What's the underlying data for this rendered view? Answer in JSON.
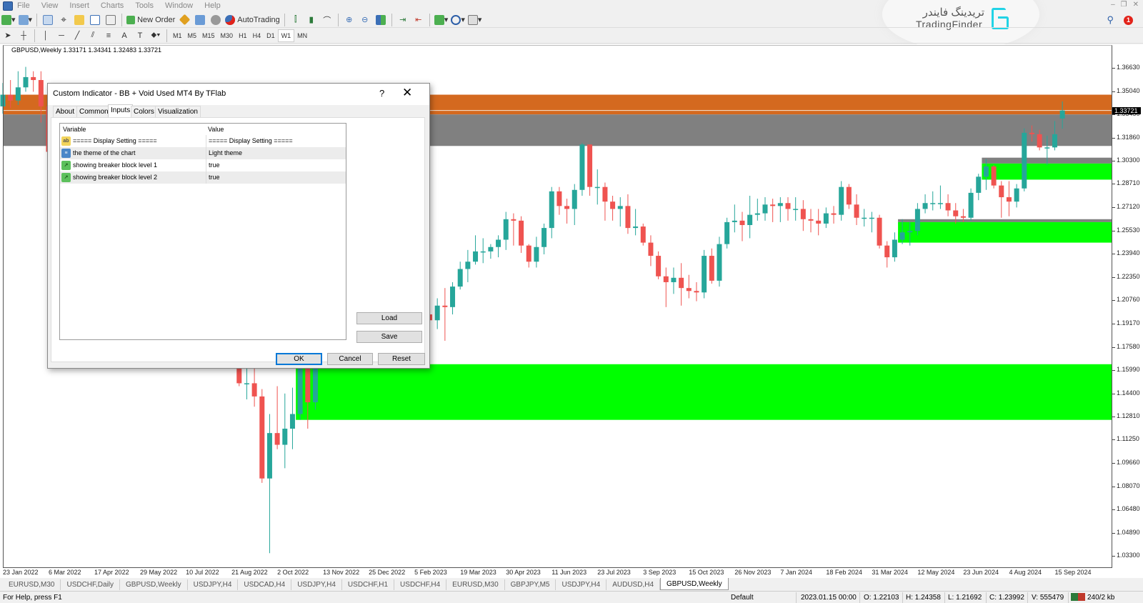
{
  "menu": {
    "items": [
      "File",
      "View",
      "Insert",
      "Charts",
      "Tools",
      "Window",
      "Help"
    ]
  },
  "toolbar": {
    "new_order": "New Order",
    "autotrading": "AutoTrading",
    "timeframes": [
      "M1",
      "M5",
      "M15",
      "M30",
      "H1",
      "H4",
      "D1",
      "W1",
      "MN"
    ],
    "active_timeframe": "W1",
    "notification_count": "1"
  },
  "logo": {
    "fa": "تریدینگ فایندر",
    "en": "TradingFinder"
  },
  "chart": {
    "header": "GBPUSD,Weekly  1.33171 1.34341 1.32483 1.33721",
    "current_price": "1.33721",
    "colors": {
      "bull": "#26a69a",
      "bear": "#ef5350",
      "supply_zone": "#d4691f",
      "gray_zone": "#808080",
      "demand_zone": "#00ff00"
    }
  },
  "chart_data": {
    "type": "candlestick",
    "symbol": "GBPUSD",
    "timeframe": "Weekly",
    "first_bar": "2022-01-23",
    "ylim": [
      1.033,
      1.3663
    ],
    "price_ticks": [
      "1.36630",
      "1.35040",
      "1.33450",
      "1.31860",
      "1.30300",
      "1.28710",
      "1.27120",
      "1.25530",
      "1.23940",
      "1.22350",
      "1.20760",
      "1.19170",
      "1.17580",
      "1.15990",
      "1.14400",
      "1.12810",
      "1.11250",
      "1.09660",
      "1.08070",
      "1.06480",
      "1.04890",
      "1.03300"
    ],
    "date_ticks": [
      "23 Jan 2022",
      "6 Mar 2022",
      "17 Apr 2022",
      "29 May 2022",
      "10 Jul 2022",
      "21 Aug 2022",
      "2 Oct 2022",
      "13 Nov 2022",
      "25 Dec 2022",
      "5 Feb 2023",
      "19 Mar 2023",
      "30 Apr 2023",
      "11 Jun 2023",
      "23 Jul 2023",
      "3 Sep 2023",
      "15 Oct 2023",
      "26 Nov 2023",
      "7 Jan 2024",
      "18 Feb 2024",
      "31 Mar 2024",
      "12 May 2024",
      "23 Jun 2024",
      "4 Aug 2024",
      "15 Sep 2024"
    ],
    "ohlc": [
      [
        1.34,
        1.356,
        1.335,
        1.348
      ],
      [
        1.348,
        1.358,
        1.339,
        1.344
      ],
      [
        1.344,
        1.364,
        1.341,
        1.353
      ],
      [
        1.353,
        1.367,
        1.35,
        1.36
      ],
      [
        1.36,
        1.364,
        1.35,
        1.358
      ],
      [
        1.358,
        1.364,
        1.329,
        1.34
      ],
      [
        1.34,
        1.342,
        1.3,
        1.309
      ],
      [
        1.309,
        1.321,
        1.305,
        1.317
      ],
      [
        1.317,
        1.325,
        1.311,
        1.318
      ],
      [
        1.318,
        1.322,
        1.305,
        1.312
      ],
      [
        1.312,
        1.318,
        1.302,
        1.307
      ],
      [
        1.307,
        1.315,
        1.298,
        1.306
      ],
      [
        1.306,
        1.31,
        1.28,
        1.284
      ],
      [
        1.284,
        1.286,
        1.25,
        1.257
      ],
      [
        1.257,
        1.266,
        1.232,
        1.234
      ],
      [
        1.234,
        1.24,
        1.216,
        1.226
      ],
      [
        1.226,
        1.251,
        1.222,
        1.248
      ],
      [
        1.248,
        1.265,
        1.241,
        1.262
      ],
      [
        1.262,
        1.266,
        1.24,
        1.245
      ],
      [
        1.245,
        1.26,
        1.22,
        1.232
      ],
      [
        1.232,
        1.236,
        1.193,
        1.226
      ],
      [
        1.226,
        1.234,
        1.216,
        1.226
      ],
      [
        1.226,
        1.232,
        1.206,
        1.21
      ],
      [
        1.21,
        1.214,
        1.188,
        1.189
      ],
      [
        1.189,
        1.2,
        1.176,
        1.188
      ],
      [
        1.188,
        1.206,
        1.183,
        1.201
      ],
      [
        1.201,
        1.225,
        1.194,
        1.217
      ],
      [
        1.217,
        1.229,
        1.21,
        1.213
      ],
      [
        1.213,
        1.227,
        1.201,
        1.213
      ],
      [
        1.213,
        1.216,
        1.176,
        1.177
      ],
      [
        1.177,
        1.182,
        1.165,
        1.174
      ],
      [
        1.174,
        1.178,
        1.149,
        1.151
      ],
      [
        1.151,
        1.165,
        1.14,
        1.151
      ],
      [
        1.151,
        1.174,
        1.135,
        1.142
      ],
      [
        1.142,
        1.147,
        1.083,
        1.086
      ],
      [
        1.086,
        1.13,
        1.035,
        1.117
      ],
      [
        1.117,
        1.149,
        1.106,
        1.109
      ],
      [
        1.109,
        1.144,
        1.093,
        1.12
      ],
      [
        1.12,
        1.148,
        1.106,
        1.13
      ],
      [
        1.13,
        1.166,
        1.126,
        1.161
      ],
      [
        1.161,
        1.167,
        1.12,
        1.138
      ],
      [
        1.138,
        1.18,
        1.133,
        1.176
      ],
      [
        1.176,
        1.195,
        1.171,
        1.189
      ],
      [
        1.189,
        1.215,
        1.186,
        1.21
      ],
      [
        1.21,
        1.235,
        1.2,
        1.227
      ],
      [
        1.227,
        1.235,
        1.215,
        1.226
      ],
      [
        1.226,
        1.245,
        1.21,
        1.216
      ],
      [
        1.216,
        1.224,
        1.199,
        1.208
      ],
      [
        1.208,
        1.215,
        1.203,
        1.21
      ],
      [
        1.21,
        1.217,
        1.184,
        1.209
      ],
      [
        1.209,
        1.225,
        1.205,
        1.222
      ],
      [
        1.222,
        1.244,
        1.213,
        1.239
      ],
      [
        1.239,
        1.245,
        1.227,
        1.24
      ],
      [
        1.24,
        1.246,
        1.2,
        1.205
      ],
      [
        1.205,
        1.215,
        1.193,
        1.211
      ],
      [
        1.211,
        1.221,
        1.196,
        1.198
      ],
      [
        1.198,
        1.21,
        1.192,
        1.194
      ],
      [
        1.194,
        1.209,
        1.188,
        1.204
      ],
      [
        1.204,
        1.216,
        1.18,
        1.203
      ],
      [
        1.203,
        1.22,
        1.198,
        1.217
      ],
      [
        1.217,
        1.234,
        1.215,
        1.229
      ],
      [
        1.229,
        1.242,
        1.22,
        1.234
      ],
      [
        1.234,
        1.252,
        1.232,
        1.241
      ],
      [
        1.241,
        1.25,
        1.233,
        1.241
      ],
      [
        1.241,
        1.246,
        1.236,
        1.244
      ],
      [
        1.244,
        1.252,
        1.237,
        1.249
      ],
      [
        1.249,
        1.268,
        1.242,
        1.263
      ],
      [
        1.263,
        1.267,
        1.245,
        1.262
      ],
      [
        1.262,
        1.265,
        1.24,
        1.245
      ],
      [
        1.245,
        1.246,
        1.23,
        1.234
      ],
      [
        1.234,
        1.251,
        1.23,
        1.244
      ],
      [
        1.244,
        1.26,
        1.239,
        1.257
      ],
      [
        1.257,
        1.285,
        1.25,
        1.282
      ],
      [
        1.282,
        1.285,
        1.266,
        1.272
      ],
      [
        1.272,
        1.277,
        1.26,
        1.27
      ],
      [
        1.27,
        1.287,
        1.259,
        1.283
      ],
      [
        1.283,
        1.315,
        1.279,
        1.314
      ],
      [
        1.314,
        1.314,
        1.279,
        1.285
      ],
      [
        1.285,
        1.297,
        1.273,
        1.285
      ],
      [
        1.285,
        1.288,
        1.262,
        1.275
      ],
      [
        1.275,
        1.279,
        1.262,
        1.27
      ],
      [
        1.27,
        1.278,
        1.258,
        1.272
      ],
      [
        1.272,
        1.28,
        1.253,
        1.257
      ],
      [
        1.257,
        1.27,
        1.252,
        1.258
      ],
      [
        1.258,
        1.26,
        1.245,
        1.247
      ],
      [
        1.247,
        1.252,
        1.231,
        1.238
      ],
      [
        1.238,
        1.241,
        1.222,
        1.224
      ],
      [
        1.224,
        1.23,
        1.203,
        1.22
      ],
      [
        1.22,
        1.23,
        1.212,
        1.223
      ],
      [
        1.223,
        1.233,
        1.204,
        1.216
      ],
      [
        1.216,
        1.225,
        1.209,
        1.214
      ],
      [
        1.214,
        1.22,
        1.207,
        1.213
      ],
      [
        1.213,
        1.242,
        1.209,
        1.238
      ],
      [
        1.238,
        1.243,
        1.219,
        1.221
      ],
      [
        1.221,
        1.251,
        1.217,
        1.246
      ],
      [
        1.246,
        1.264,
        1.243,
        1.261
      ],
      [
        1.261,
        1.273,
        1.254,
        1.262
      ],
      [
        1.262,
        1.268,
        1.248,
        1.259
      ],
      [
        1.259,
        1.279,
        1.25,
        1.266
      ],
      [
        1.266,
        1.277,
        1.262,
        1.267
      ],
      [
        1.267,
        1.278,
        1.262,
        1.273
      ],
      [
        1.273,
        1.277,
        1.261,
        1.272
      ],
      [
        1.272,
        1.278,
        1.261,
        1.274
      ],
      [
        1.274,
        1.278,
        1.262,
        1.27
      ],
      [
        1.27,
        1.278,
        1.262,
        1.27
      ],
      [
        1.27,
        1.276,
        1.255,
        1.263
      ],
      [
        1.263,
        1.27,
        1.254,
        1.262
      ],
      [
        1.262,
        1.27,
        1.252,
        1.26
      ],
      [
        1.26,
        1.271,
        1.257,
        1.267
      ],
      [
        1.267,
        1.272,
        1.26,
        1.266
      ],
      [
        1.266,
        1.289,
        1.262,
        1.285
      ],
      [
        1.285,
        1.287,
        1.27,
        1.273
      ],
      [
        1.273,
        1.28,
        1.259,
        1.264
      ],
      [
        1.264,
        1.27,
        1.258,
        1.264
      ],
      [
        1.264,
        1.268,
        1.254,
        1.264
      ],
      [
        1.264,
        1.266,
        1.243,
        1.245
      ],
      [
        1.245,
        1.248,
        1.23,
        1.237
      ],
      [
        1.237,
        1.254,
        1.234,
        1.249
      ],
      [
        1.249,
        1.263,
        1.246,
        1.254
      ],
      [
        1.254,
        1.261,
        1.245,
        1.255
      ],
      [
        1.255,
        1.274,
        1.252,
        1.27
      ],
      [
        1.27,
        1.28,
        1.267,
        1.274
      ],
      [
        1.274,
        1.282,
        1.269,
        1.274
      ],
      [
        1.274,
        1.286,
        1.27,
        1.274
      ],
      [
        1.274,
        1.28,
        1.265,
        1.269
      ],
      [
        1.269,
        1.274,
        1.26,
        1.265
      ],
      [
        1.265,
        1.27,
        1.261,
        1.264
      ],
      [
        1.264,
        1.284,
        1.262,
        1.281
      ],
      [
        1.281,
        1.294,
        1.276,
        1.292
      ],
      [
        1.292,
        1.304,
        1.283,
        1.299
      ],
      [
        1.299,
        1.3,
        1.284,
        1.286
      ],
      [
        1.286,
        1.289,
        1.264,
        1.278
      ],
      [
        1.278,
        1.289,
        1.265,
        1.275
      ],
      [
        1.275,
        1.287,
        1.271,
        1.284
      ],
      [
        1.284,
        1.325,
        1.282,
        1.322
      ],
      [
        1.322,
        1.327,
        1.316,
        1.321
      ],
      [
        1.321,
        1.324,
        1.31,
        1.312
      ],
      [
        1.312,
        1.32,
        1.3,
        1.312
      ],
      [
        1.312,
        1.33,
        1.31,
        1.321
      ],
      [
        1.3317,
        1.3434,
        1.3248,
        1.3372
      ]
    ],
    "zones": [
      {
        "kind": "supply",
        "color": "#d4691f",
        "start": "2022-01-23",
        "low": 1.3345,
        "high": 1.348
      },
      {
        "kind": "breaker",
        "color": "#808080",
        "start": "2022-01-23",
        "low": 1.313,
        "high": 1.3345
      },
      {
        "kind": "demand",
        "color": "#00ff00",
        "start": "2022-10-23",
        "low": 1.126,
        "high": 1.164
      },
      {
        "kind": "breaker",
        "color": "#808080",
        "start": "2024-04-28",
        "low": 1.261,
        "high": 1.263
      },
      {
        "kind": "demand",
        "color": "#00ff00",
        "start": "2024-04-28",
        "low": 1.247,
        "high": 1.261
      },
      {
        "kind": "breaker",
        "color": "#808080",
        "start": "2024-07-14",
        "low": 1.301,
        "high": 1.305
      },
      {
        "kind": "demand",
        "color": "#00ff00",
        "start": "2024-07-14",
        "low": 1.29,
        "high": 1.301
      }
    ],
    "current_price_line": 1.33721
  },
  "dialog": {
    "title": "Custom Indicator - BB + Void Used MT4 By TFlab",
    "help": "?",
    "tabs": [
      "About",
      "Common",
      "Inputs",
      "Colors",
      "Visualization"
    ],
    "active_tab": "Inputs",
    "columns": [
      "Variable",
      "Value"
    ],
    "rows": [
      {
        "icon": "ab",
        "variable": "===== Display Setting =====",
        "value": "===== Display Setting ====="
      },
      {
        "icon": "enum",
        "variable": "the theme of the chart",
        "value": "Light theme"
      },
      {
        "icon": "bool",
        "variable": "showing breaker block level 1",
        "value": "true"
      },
      {
        "icon": "bool",
        "variable": "showing breaker block level 2",
        "value": "true"
      }
    ],
    "buttons": {
      "load": "Load",
      "save": "Save",
      "ok": "OK",
      "cancel": "Cancel",
      "reset": "Reset"
    }
  },
  "chart_tabs": [
    "EURUSD,M30",
    "USDCHF,Daily",
    "GBPUSD,Weekly",
    "USDJPY,H4",
    "USDCAD,H4",
    "USDJPY,H4",
    "USDCHF,H1",
    "USDCHF,H4",
    "EURUSD,M30",
    "GBPJPY,M5",
    "USDJPY,H4",
    "AUDUSD,H4",
    "GBPUSD,Weekly"
  ],
  "active_chart_tab": 12,
  "status": {
    "help": "For Help, press F1",
    "profile": "Default",
    "time": "2023.01.15 00:00",
    "open": "O: 1.22103",
    "high": "H: 1.24358",
    "low": "L: 1.21692",
    "close": "C: 1.23992",
    "volume": "V: 555479",
    "traffic": "240/2 kb"
  }
}
